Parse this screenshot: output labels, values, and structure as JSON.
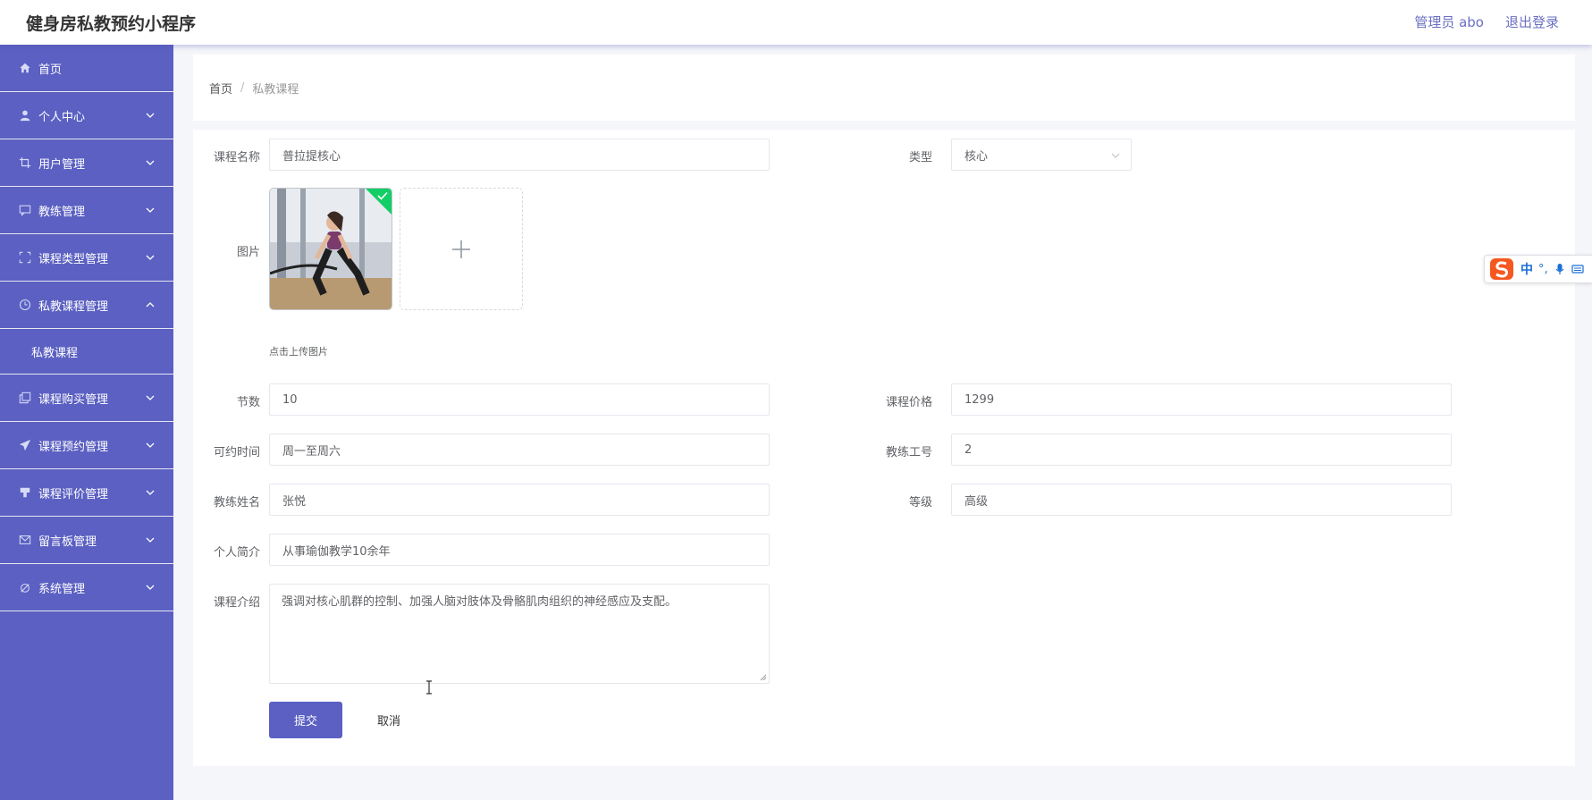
{
  "header": {
    "title": "健身房私教预约小程序",
    "admin_label": "管理员 abo",
    "logout_label": "退出登录"
  },
  "sidebar": {
    "items": [
      {
        "label": "首页",
        "icon": "home-icon"
      },
      {
        "label": "个人中心",
        "icon": "user-icon"
      },
      {
        "label": "用户管理",
        "icon": "crop-icon"
      },
      {
        "label": "教练管理",
        "icon": "message-icon"
      },
      {
        "label": "课程类型管理",
        "icon": "fullscreen-icon"
      },
      {
        "label": "私教课程管理",
        "icon": "clock-icon",
        "expanded": true
      },
      {
        "label": "课程购买管理",
        "icon": "copy-icon"
      },
      {
        "label": "课程预约管理",
        "icon": "send-icon"
      },
      {
        "label": "课程评价管理",
        "icon": "thumb-icon"
      },
      {
        "label": "留言板管理",
        "icon": "mail-icon"
      },
      {
        "label": "系统管理",
        "icon": "settings-icon"
      }
    ],
    "sub_item": "私教课程"
  },
  "breadcrumb": {
    "home": "首页",
    "separator": "/",
    "current": "私教课程"
  },
  "form": {
    "course_name": {
      "label": "课程名称",
      "value": "普拉提核心"
    },
    "type": {
      "label": "类型",
      "value": "核心"
    },
    "image": {
      "label": "图片",
      "tip": "点击上传图片"
    },
    "sessions": {
      "label": "节数",
      "value": "10"
    },
    "price": {
      "label": "课程价格",
      "value": "1299"
    },
    "available_time": {
      "label": "可约时间",
      "value": "周一至周六"
    },
    "coach_id": {
      "label": "教练工号",
      "value": "2"
    },
    "coach_name": {
      "label": "教练姓名",
      "value": "张悦"
    },
    "level": {
      "label": "等级",
      "value": "高级"
    },
    "bio": {
      "label": "个人简介",
      "value": "从事瑜伽教学10余年"
    },
    "intro": {
      "label": "课程介绍",
      "value": "强调对核心肌群的控制、加强人脑对肢体及骨骼肌肉组织的神经感应及支配。"
    },
    "submit_label": "提交",
    "cancel_label": "取消"
  },
  "ime": {
    "mode": "中",
    "punct": "°,"
  },
  "colors": {
    "sidebar": "#5b60c2",
    "accent": "#5b60c2",
    "success": "#13ce66"
  }
}
